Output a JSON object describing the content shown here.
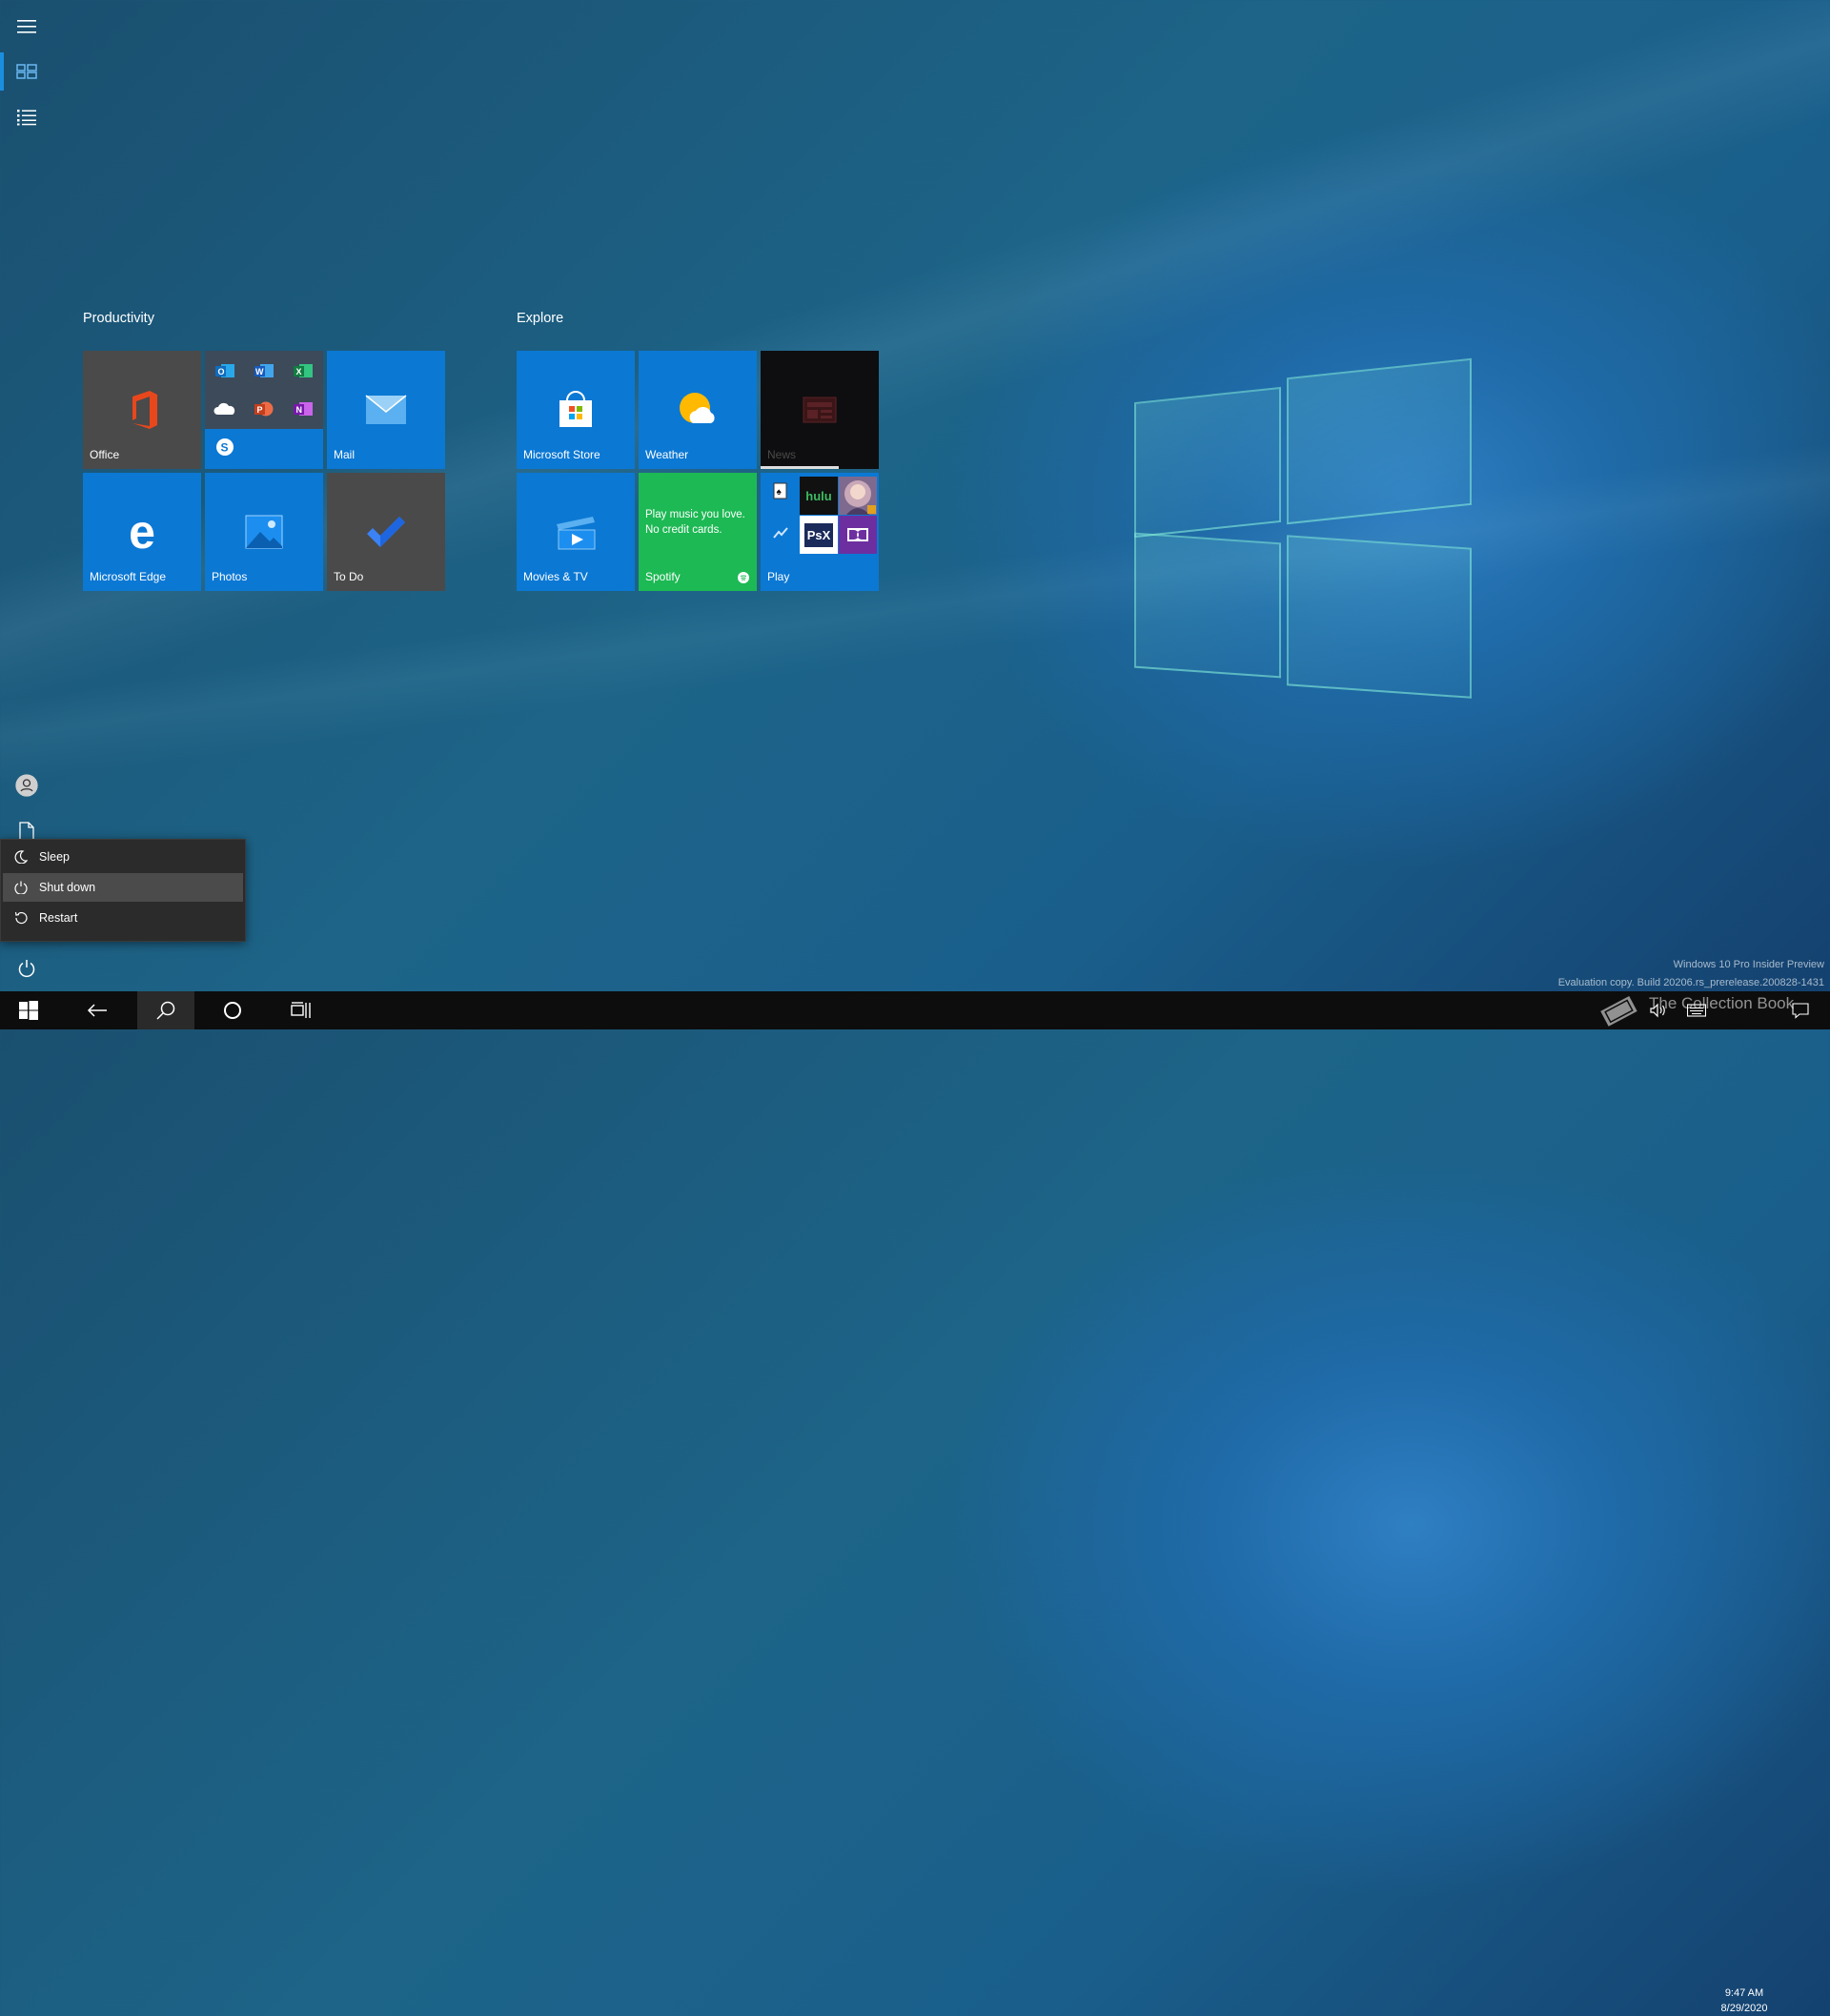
{
  "rail": {
    "menu_icon": "hamburger-icon",
    "tiles_icon": "pinned-tiles-icon",
    "list_icon": "all-apps-list-icon",
    "user_icon": "user-account-icon",
    "documents_icon": "document-icon",
    "power_icon": "power-icon"
  },
  "groups": {
    "productivity": {
      "title": "Productivity",
      "office": "Office",
      "mail": "Mail",
      "edge": "Microsoft Edge",
      "photos": "Photos",
      "todo": "To Do"
    },
    "explore": {
      "title": "Explore",
      "store": "Microsoft Store",
      "weather": "Weather",
      "news": "News",
      "movies": "Movies & TV",
      "spotify_promo": "Play music you love. No credit cards.",
      "spotify": "Spotify",
      "play": "Play",
      "hulu": "hulu",
      "psx": "PsX"
    }
  },
  "power_menu": {
    "items": [
      {
        "label": "Sleep",
        "icon": "moon-icon"
      },
      {
        "label": "Shut down",
        "icon": "power-icon"
      },
      {
        "label": "Restart",
        "icon": "restart-icon"
      }
    ]
  },
  "watermark": {
    "line1": "Windows 10 Pro Insider Preview",
    "line2": "Evaluation copy. Build 20206.rs_prerelease.200828-1431",
    "brand": "The Collection Book"
  },
  "taskbar": {
    "time": "9:47 AM",
    "date": "8/29/2020"
  },
  "colors": {
    "tile_blue": "#0b78d4",
    "tile_dark": "#4a4a4a",
    "spotify_green": "#1db954",
    "accent": "#1a8fe0"
  }
}
